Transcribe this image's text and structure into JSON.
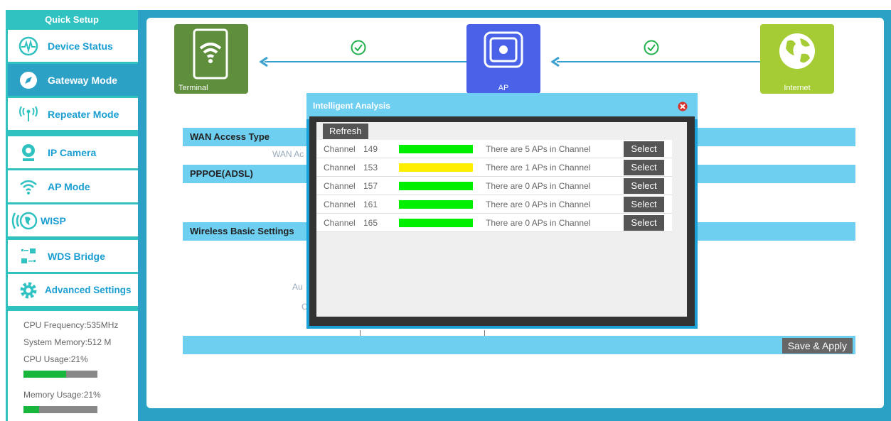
{
  "sidebar": {
    "title": "Quick Setup",
    "items": [
      {
        "label": "Device Status",
        "icon": "pulse-icon"
      },
      {
        "label": "Gateway Mode",
        "icon": "compass-icon"
      },
      {
        "label": "Repeater Mode",
        "icon": "broadcast-icon"
      },
      {
        "label": "IP Camera",
        "icon": "camera-icon"
      },
      {
        "label": "AP Mode",
        "icon": "wifi-icon"
      },
      {
        "label": "WISP",
        "icon": "wisp-icon"
      },
      {
        "label": "WDS Bridge",
        "icon": "bridge-icon"
      },
      {
        "label": "Advanced Settings",
        "icon": "gear-icon"
      }
    ],
    "active_index": 1,
    "stats": {
      "cpu_frequency": "CPU Frequency:535MHz",
      "system_memory": "System Memory:512 M",
      "cpu_usage": "CPU Usage:21%",
      "cpu_usage_value": 0.58,
      "memory_usage": "Memory Usage:21%",
      "memory_usage_value": 0.21
    }
  },
  "flow": {
    "terminal_label": "Terminal",
    "ap_label": "AP",
    "internet_label": "Internet",
    "colors": {
      "terminal": "#5f8f3d",
      "ap": "#4a62e8",
      "internet": "#a6cc35",
      "check": "#23b14d",
      "arrow": "#3aa0d0"
    }
  },
  "sections": {
    "wan_access_type": "WAN Access Type",
    "wan_access_ghost": "WAN Ac",
    "pppoe": "PPPOE(ADSL)",
    "wireless_basic": "Wireless Basic Settings",
    "ghost_au": "Au",
    "ghost_c": "C"
  },
  "buttons": {
    "save_apply": "Save & Apply"
  },
  "modal": {
    "title": "Intelligent Analysis",
    "refresh_label": "Refresh",
    "channels": [
      {
        "channel_label": "Channel",
        "number": "149",
        "text": "There are 5 APs in Channel",
        "level_color": "#00ee00",
        "select_label": "Select"
      },
      {
        "channel_label": "Channel",
        "number": "153",
        "text": "There are 1 APs in Channel",
        "level_color": "#ffee00",
        "select_label": "Select"
      },
      {
        "channel_label": "Channel",
        "number": "157",
        "text": "There are 0 APs in Channel",
        "level_color": "#00ee00",
        "select_label": "Select"
      },
      {
        "channel_label": "Channel",
        "number": "161",
        "text": "There are 0 APs in Channel",
        "level_color": "#00ee00",
        "select_label": "Select"
      },
      {
        "channel_label": "Channel",
        "number": "165",
        "text": "There are 0 APs in Channel",
        "level_color": "#00ee00",
        "select_label": "Select"
      }
    ]
  }
}
